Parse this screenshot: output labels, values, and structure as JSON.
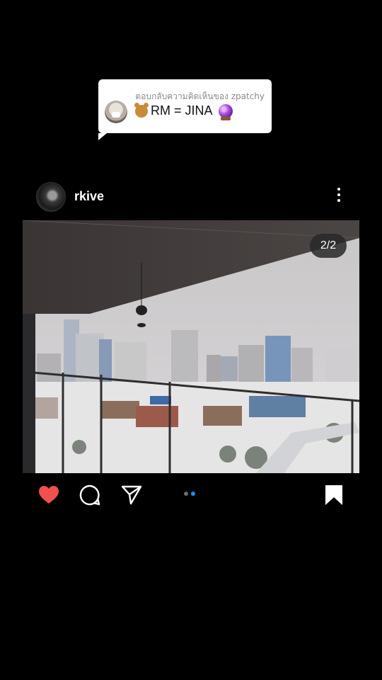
{
  "reply": {
    "header": "ตอบกลับความคิดเห็นของ zpatchy",
    "text": "RM = JINA",
    "emoji_left": "teddy-bear",
    "emoji_right": "crystal-ball"
  },
  "post": {
    "username": "rkive",
    "counter": "2/2",
    "carousel": {
      "total": 2,
      "active": 2
    },
    "liked": true,
    "saved": true
  },
  "colors": {
    "like": "#f0504f",
    "carousel_active": "#1e8ef0",
    "background": "#000000"
  }
}
